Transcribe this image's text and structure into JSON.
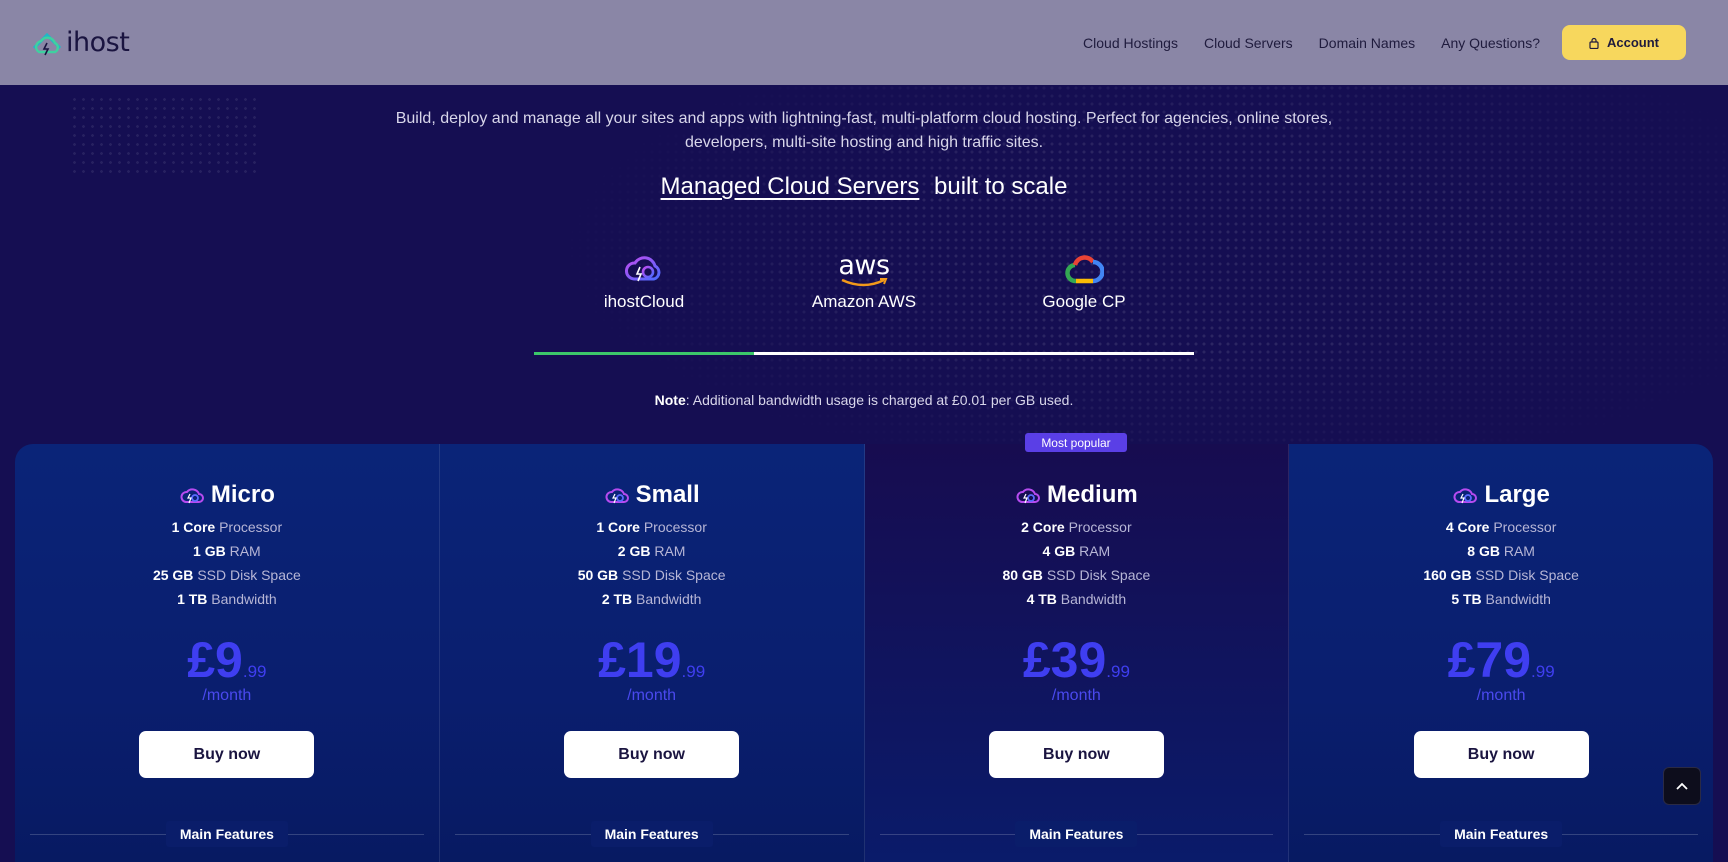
{
  "header": {
    "logo_text": "ihost",
    "nav": [
      "Cloud Hostings",
      "Cloud Servers",
      "Domain Names",
      "Any Questions?"
    ],
    "account_label": "Account"
  },
  "hero": {
    "intro": "Build, deploy and manage all your sites and apps with lightning-fast, multi-platform cloud hosting. Perfect for agencies, online stores, developers, multi-site hosting and high traffic sites.",
    "headline_link": "Managed Cloud Servers",
    "headline_rest": "built to scale"
  },
  "providers": [
    {
      "label": "ihostCloud",
      "icon": "ihostcloud-icon"
    },
    {
      "label": "Amazon AWS",
      "icon": "aws-logo",
      "logo_text": "aws"
    },
    {
      "label": "Google CP",
      "icon": "google-cloud-icon"
    }
  ],
  "active_provider": "ihostCloud",
  "note": {
    "bold": "Note",
    "text": ": Additional bandwidth usage is charged at £0.01 per GB used."
  },
  "badge": "Most popular",
  "plans": [
    {
      "name": "Micro",
      "core": "1 Core",
      "core_label": "Processor",
      "ram": "1 GB",
      "ram_label": "RAM",
      "disk": "25 GB",
      "disk_label": "SSD Disk Space",
      "bw": "1 TB",
      "bw_label": "Bandwidth",
      "price": "£9",
      "cents": ".99",
      "per": "/month",
      "button": "Buy now",
      "features": "Main Features"
    },
    {
      "name": "Small",
      "core": "1 Core",
      "core_label": "Processor",
      "ram": "2 GB",
      "ram_label": "RAM",
      "disk": "50 GB",
      "disk_label": "SSD Disk Space",
      "bw": "2 TB",
      "bw_label": "Bandwidth",
      "price": "£19",
      "cents": ".99",
      "per": "/month",
      "button": "Buy now",
      "features": "Main Features"
    },
    {
      "name": "Medium",
      "core": "2 Core",
      "core_label": "Processor",
      "ram": "4 GB",
      "ram_label": "RAM",
      "disk": "80 GB",
      "disk_label": "SSD Disk Space",
      "bw": "4 TB",
      "bw_label": "Bandwidth",
      "price": "£39",
      "cents": ".99",
      "per": "/month",
      "button": "Buy now",
      "features": "Main Features"
    },
    {
      "name": "Large",
      "core": "4 Core",
      "core_label": "Processor",
      "ram": "8 GB",
      "ram_label": "RAM",
      "disk": "160 GB",
      "disk_label": "SSD Disk Space",
      "bw": "5 TB",
      "bw_label": "Bandwidth",
      "price": "£79",
      "cents": ".99",
      "per": "/month",
      "button": "Buy now",
      "features": "Main Features"
    }
  ],
  "colors": {
    "background": "#150e52",
    "header": "#8a86a6",
    "accent_yellow": "#f7d75d",
    "price_blue": "#3f3ef0",
    "tab_active": "#3cc86a",
    "badge": "#5a3fe6"
  }
}
